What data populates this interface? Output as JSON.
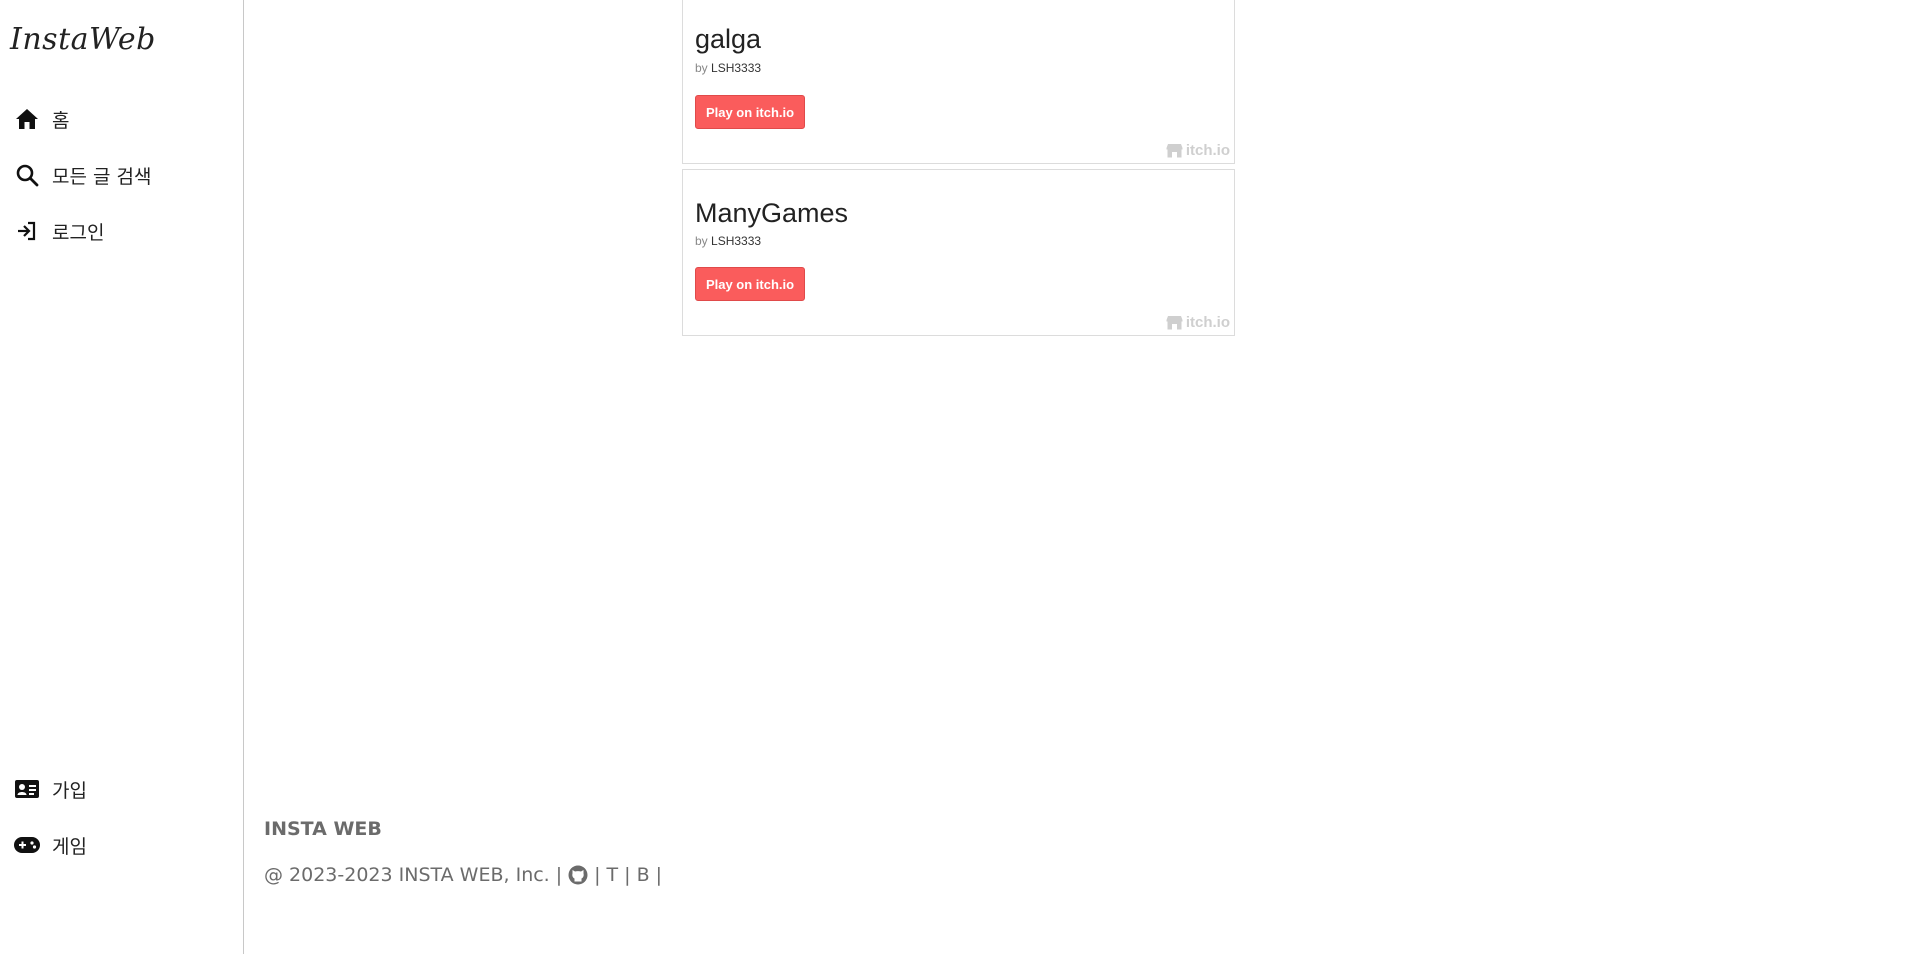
{
  "sidebar": {
    "logo": "InstaWeb",
    "nav": {
      "home": "홈",
      "search": "모든 글 검색",
      "login": "로그인",
      "join": "가입",
      "game": "게임"
    }
  },
  "games": [
    {
      "title": "galga",
      "by": "by",
      "author": "LSH3333",
      "button": "Play on itch.io",
      "badge": "itch.io"
    },
    {
      "title": "ManyGames",
      "by": "by",
      "author": "LSH3333",
      "button": "Play on itch.io",
      "badge": "itch.io"
    }
  ],
  "footer": {
    "title": "INSTA WEB",
    "copyright": "@ 2023-2023 INSTA WEB, Inc.",
    "sep": "|",
    "link_t": "T",
    "link_b": "B"
  },
  "colors": {
    "accent": "#fa5c5c",
    "footer_text": "#6b6b6b"
  },
  "icons": [
    "home-icon",
    "search-icon",
    "login-icon",
    "id-card-icon",
    "gamepad-icon",
    "github-icon",
    "itchio-icon"
  ]
}
